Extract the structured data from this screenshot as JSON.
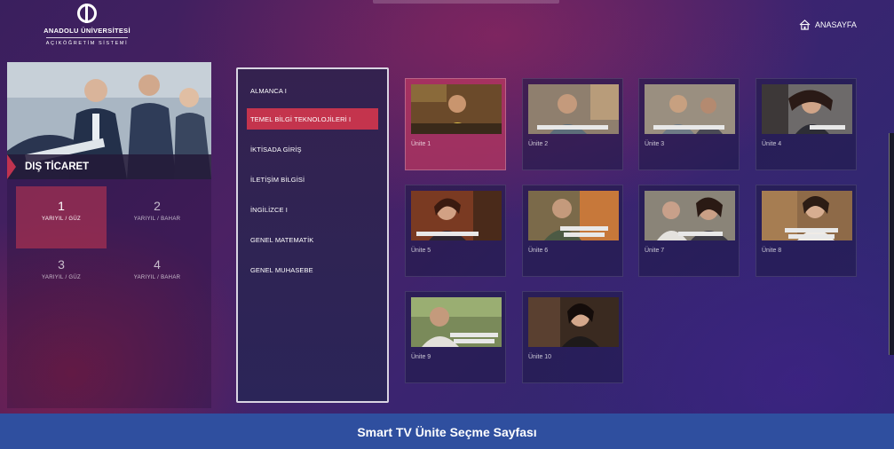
{
  "header": {
    "logo_line1": "ANADOLU ÜNİVERSİTESİ",
    "logo_line2": "AÇIKÖĞRETİM SİSTEMİ",
    "home_label": "ANASAYFA"
  },
  "program": {
    "title": "DIŞ TİCARET",
    "semesters": [
      {
        "number": "1",
        "label": "YARIYIL / GÜZ"
      },
      {
        "number": "2",
        "label": "YARIYIL / BAHAR"
      },
      {
        "number": "3",
        "label": "YARIYIL / GÜZ"
      },
      {
        "number": "4",
        "label": "YARIYIL / BAHAR"
      }
    ]
  },
  "courses": [
    "ALMANCA I",
    "TEMEL BİLGİ TEKNOLOJİLERİ I",
    "İKTİSADA GİRİŞ",
    "İLETİŞİM BİLGİSİ",
    "İNGİLİZCE I",
    "GENEL MATEMATİK",
    "GENEL MUHASEBE"
  ],
  "units": [
    "Ünite 1",
    "Ünite 2",
    "Ünite 3",
    "Ünite 4",
    "Ünite 5",
    "Ünite 6",
    "Ünite 7",
    "Ünite 8",
    "Ünite 9",
    "Ünite 10"
  ],
  "caption": "Smart TV Ünite Seçme Sayfası",
  "colors": {
    "accent": "#c4344d",
    "caption_bar": "#2f4f9f",
    "background": "#3a1f5e"
  }
}
